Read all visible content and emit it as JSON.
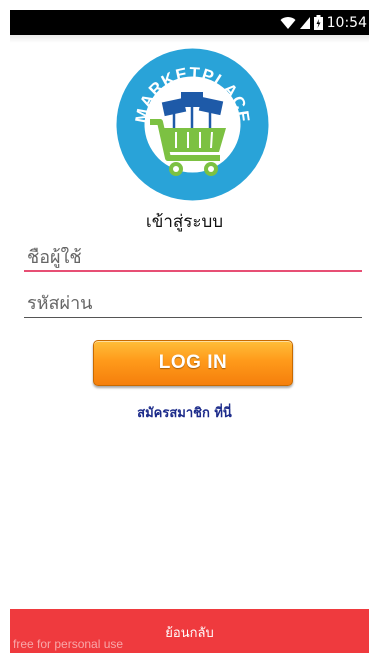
{
  "status_bar": {
    "time": "10:54",
    "icons": [
      "wifi-icon",
      "signal-icon",
      "battery-icon"
    ]
  },
  "logo": {
    "text": "MARKETPLACE",
    "colors": {
      "ring": "#29a3d8",
      "cart": "#7cc142",
      "signs": "#1e5aa8"
    }
  },
  "login": {
    "title": "เข้าสู่ระบบ",
    "username_placeholder": "ชื่อผู้ใช้",
    "password_placeholder": "รหัสผ่าน",
    "login_button": "LOG IN",
    "register_link": "สมัครสมาชิก ที่นี่"
  },
  "bottom_bar": {
    "back_label": "ย้อนกลับ",
    "watermark": "free for personal use",
    "color": "#ef3a3e"
  }
}
